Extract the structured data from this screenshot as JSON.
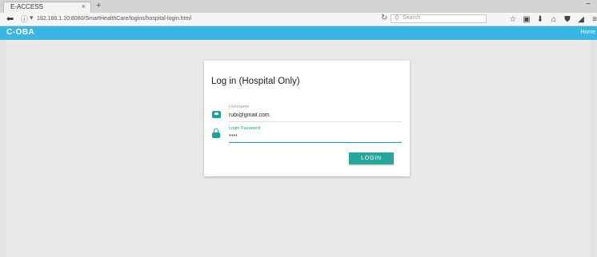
{
  "browser": {
    "tab_title": "E-ACCESS",
    "tab_close": "×",
    "new_tab": "+",
    "window_control": "−",
    "url": "192.168.1.10:8080/SmartHealthCare/logins/hospital-login.html",
    "search_placeholder": "Search",
    "icons": [
      "star-icon",
      "bookmark-icon",
      "download-icon",
      "home-icon",
      "shield-icon",
      "share-icon",
      "menu-icon"
    ],
    "icon_glyphs": [
      "☆",
      "▣",
      "⬇",
      "⌂",
      "⛊",
      "◢",
      "≡"
    ]
  },
  "app": {
    "brand": "C-OBA",
    "header_right": "Home",
    "header_color": "#38b6e4"
  },
  "login": {
    "title": "Log in (Hospital Only)",
    "username_label": "Username",
    "username_value": "rubi@gmail.com",
    "password_label": "Login Password",
    "password_value": "****",
    "submit_label": "LOGIN",
    "accent_color": "#26a69a"
  }
}
